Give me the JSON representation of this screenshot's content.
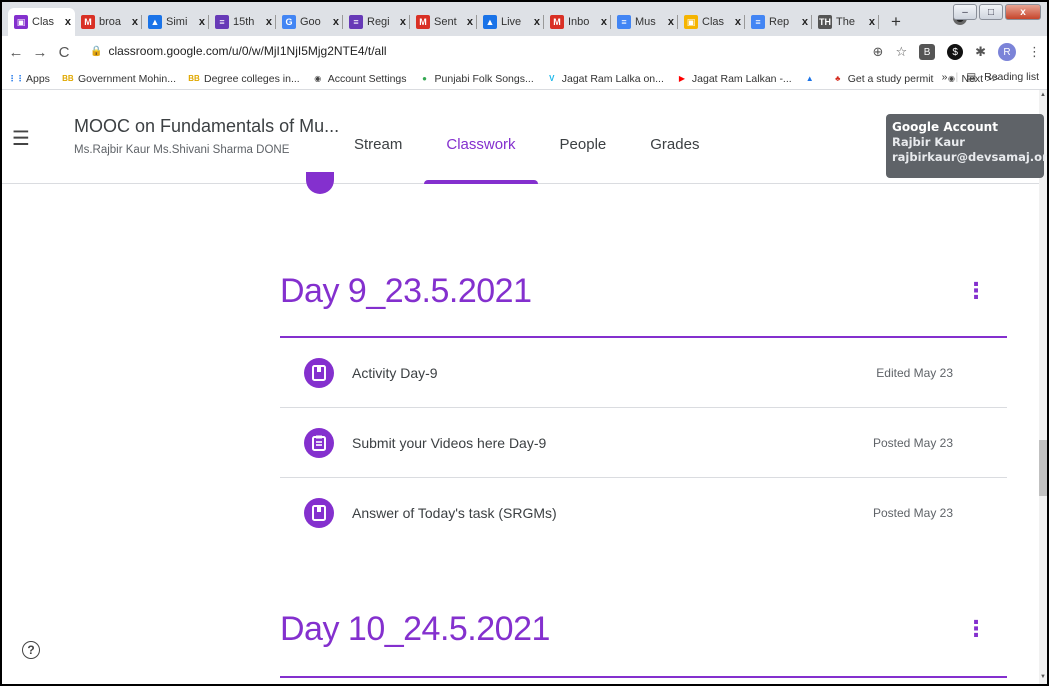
{
  "browser": {
    "tabs": [
      {
        "label": "Clas",
        "icon": "classroom-icon",
        "color": "#8430ce",
        "active": true
      },
      {
        "label": "broa",
        "icon": "gmail-icon",
        "color": "#d93025",
        "active": false
      },
      {
        "label": "Simi",
        "icon": "drive-icon",
        "color": "#1a73e8",
        "active": false
      },
      {
        "label": "15th",
        "icon": "forms-icon",
        "color": "#673ab7",
        "active": false
      },
      {
        "label": "Goo",
        "icon": "google-icon",
        "color": "#4285f4",
        "active": false
      },
      {
        "label": "Regi",
        "icon": "forms-icon",
        "color": "#673ab7",
        "active": false
      },
      {
        "label": "Sent",
        "icon": "gmail-icon",
        "color": "#d93025",
        "active": false
      },
      {
        "label": "Live",
        "icon": "drive-icon",
        "color": "#1a73e8",
        "active": false
      },
      {
        "label": "Inbo",
        "icon": "gmail-icon",
        "color": "#d93025",
        "active": false
      },
      {
        "label": "Mus",
        "icon": "docs-icon",
        "color": "#4285f4",
        "active": false
      },
      {
        "label": "Clas",
        "icon": "classroom-icon",
        "color": "#f5b400",
        "active": false
      },
      {
        "label": "Rep",
        "icon": "docs-icon",
        "color": "#4285f4",
        "active": false
      },
      {
        "label": "The",
        "icon": "th-icon",
        "color": "#555555",
        "active": false
      }
    ],
    "tab_close": "x",
    "new_tab": "+",
    "url": "classroom.google.com/u/0/w/MjI1NjI5Mjg2NTE4/t/all"
  },
  "bookmarks": {
    "items": [
      {
        "label": "Apps",
        "icon": "apps-grid-icon"
      },
      {
        "label": "Government Mohin...",
        "icon": "bb-icon"
      },
      {
        "label": "Degree colleges in...",
        "icon": "bb-icon"
      },
      {
        "label": "Account Settings",
        "icon": "globe-icon"
      },
      {
        "label": "Punjabi Folk Songs...",
        "icon": "chrome-icon"
      },
      {
        "label": "Jagat Ram Lalka on...",
        "icon": "v-icon"
      },
      {
        "label": "Jagat Ram Lalkan -...",
        "icon": "youtube-icon"
      },
      {
        "label": "",
        "icon": "drive-triangle-icon"
      },
      {
        "label": "Get a study permit",
        "icon": "maple-leaf-icon"
      },
      {
        "label": "Next >>",
        "icon": "globe-icon"
      }
    ],
    "overflow": "»",
    "reading_list": "Reading list"
  },
  "classroom": {
    "class_title": "MOOC on Fundamentals of Mu...",
    "class_subtitle": "Ms.Rajbir Kaur Ms.Shivani Sharma DONE",
    "nav": [
      "Stream",
      "Classwork",
      "People",
      "Grades"
    ],
    "active_nav": "Classwork"
  },
  "tooltip": {
    "title": "Google Account",
    "name": "Rajbir Kaur",
    "email": "rajbirkaur@devsamaj.org"
  },
  "topics": [
    {
      "title": "Day 9_23.5.2021",
      "items": [
        {
          "title": "Activity Day-9",
          "meta": "Edited May 23",
          "type": "material"
        },
        {
          "title": "Submit your Videos here Day-9",
          "meta": "Posted May 23",
          "type": "assignment"
        },
        {
          "title": "Answer of Today's task (SRGMs)",
          "meta": "Posted May 23",
          "type": "material"
        }
      ]
    },
    {
      "title": "Day 10_24.5.2021",
      "items": []
    }
  ],
  "colors": {
    "accent": "#8430ce",
    "text": "#3c4043",
    "muted": "#5f6368"
  }
}
